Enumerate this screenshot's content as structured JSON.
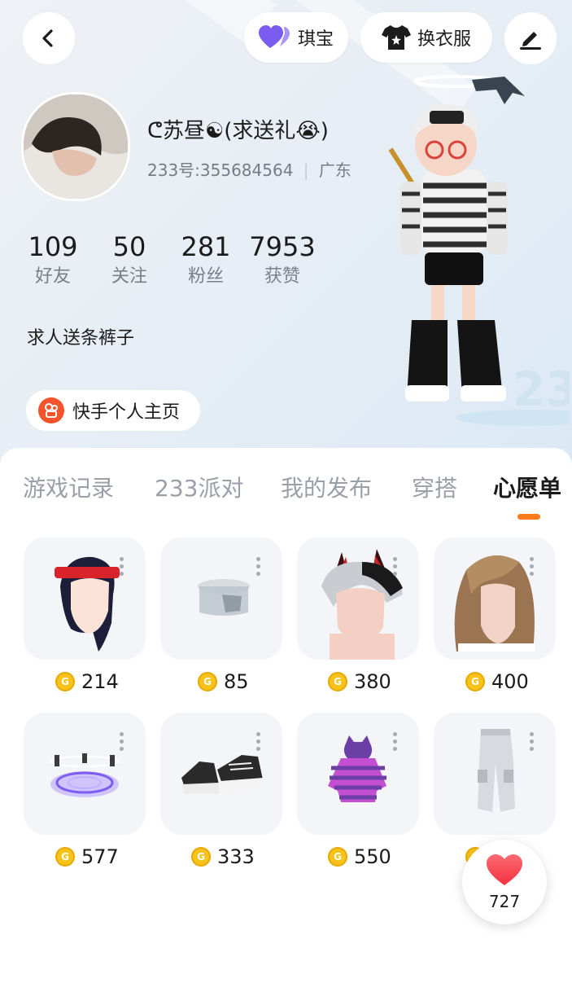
{
  "header": {
    "qibao_label": "琪宝",
    "outfit_label": "换衣服"
  },
  "profile": {
    "nickname": "ᕦ苏昼☯(求送礼😭)",
    "id_text": "233号:355684564",
    "region": "广东",
    "bio": "求人送条裤子",
    "kuaishou_label": "快手个人主页"
  },
  "stats": [
    {
      "value": "109",
      "label": "好友"
    },
    {
      "value": "50",
      "label": "关注"
    },
    {
      "value": "281",
      "label": "粉丝"
    },
    {
      "value": "7953",
      "label": "获赞"
    }
  ],
  "tabs": [
    {
      "label": "游戏记录"
    },
    {
      "label": "233派对"
    },
    {
      "label": "我的发布"
    },
    {
      "label": "穿搭"
    },
    {
      "label": "心愿单"
    }
  ],
  "active_tab": "心愿单",
  "items": [
    {
      "price": "214",
      "icon": "headband-hair-item"
    },
    {
      "price": "85",
      "icon": "visor-item"
    },
    {
      "price": "380",
      "icon": "demon-horns-hair-item"
    },
    {
      "price": "400",
      "icon": "wavy-hair-item"
    },
    {
      "price": "577",
      "icon": "magic-circle-item"
    },
    {
      "price": "333",
      "icon": "sneakers-item"
    },
    {
      "price": "550",
      "icon": "striped-hoodie-item"
    },
    {
      "price": "",
      "icon": "cargo-pants-item"
    }
  ],
  "like_count": "727",
  "colors": {
    "accent": "#ff7a1a",
    "coin": "#f7c21a",
    "heart": "#ff3b4e",
    "qibao_heart": "#7b5cf0",
    "kuaishou": "#f5532b"
  }
}
